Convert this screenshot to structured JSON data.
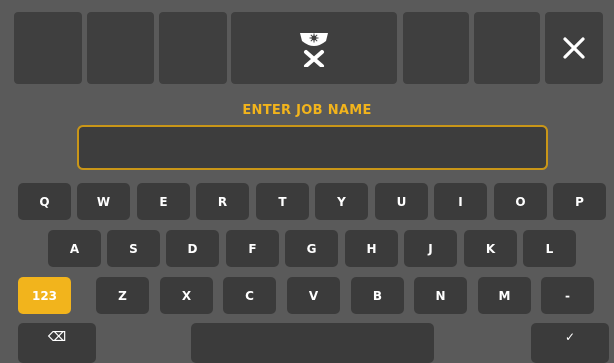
{
  "prompt": {
    "title": "ENTER JOB NAME",
    "value": ""
  },
  "keyboard": {
    "row1": [
      "Q",
      "W",
      "E",
      "R",
      "T",
      "Y",
      "U",
      "I",
      "O",
      "P"
    ],
    "row2": [
      "A",
      "S",
      "D",
      "F",
      "G",
      "H",
      "J",
      "K",
      "L"
    ],
    "row3": [
      "123",
      "Z",
      "X",
      "C",
      "V",
      "B",
      "N",
      "M",
      "-"
    ],
    "enter_glyph": "✓",
    "backspace_glyph": "⌫"
  },
  "colors": {
    "accent": "#f2b41c",
    "background": "#5a5a5a",
    "key": "#3b3b3b"
  }
}
